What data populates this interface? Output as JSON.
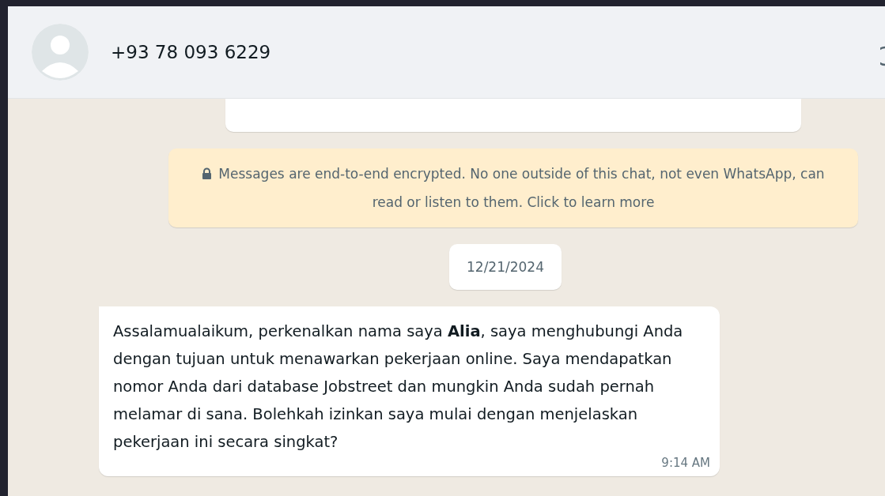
{
  "header": {
    "contact_name": "+93 78 093 6229"
  },
  "encryption_notice": {
    "text": "Messages are end-to-end encrypted. No one outside of this chat, not even WhatsApp, can read or listen to them. Click to learn more"
  },
  "date_chip": "12/21/2024",
  "messages": [
    {
      "text": "Assalamualaikum, perkenalkan nama saya **Alia**, saya menghubungi Anda dengan tujuan untuk menawarkan pekerjaan online. Saya mendapatkan nomor Anda dari database Jobstreet dan mungkin Anda sudah pernah melamar di sana. Bolehkah izinkan saya mulai dengan menjelaskan pekerjaan ini secara singkat?",
      "time": "9:14 AM"
    }
  ]
}
